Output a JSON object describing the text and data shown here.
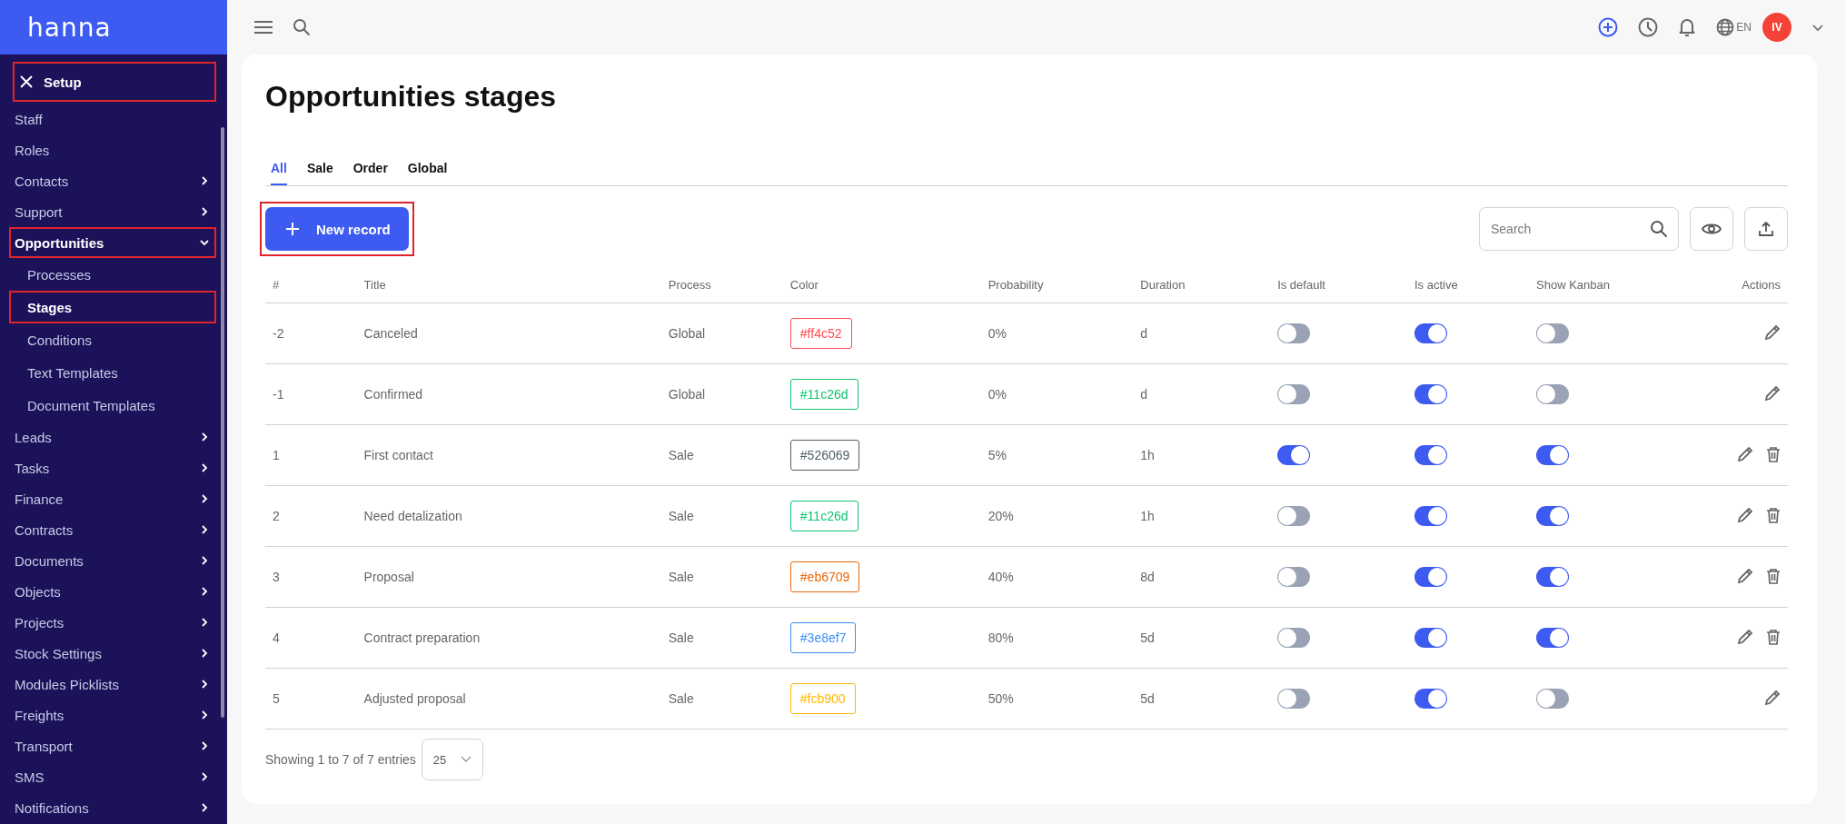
{
  "logo": "hanna",
  "sidebar": {
    "items": [
      {
        "kind": "header",
        "label": "Setup",
        "highlighted": true
      },
      {
        "kind": "link",
        "label": "Staff",
        "highlighted": false
      },
      {
        "kind": "link",
        "label": "Roles",
        "highlighted": false
      },
      {
        "kind": "group",
        "label": "Contacts",
        "expanded": false,
        "highlighted": false
      },
      {
        "kind": "group",
        "label": "Support",
        "expanded": false,
        "highlighted": false
      },
      {
        "kind": "group",
        "label": "Opportunities",
        "expanded": true,
        "highlighted": true,
        "children": [
          {
            "label": "Processes",
            "selected": false,
            "highlighted": false
          },
          {
            "label": "Stages",
            "selected": true,
            "highlighted": true
          },
          {
            "label": "Conditions",
            "selected": false,
            "highlighted": false
          },
          {
            "label": "Text Templates",
            "selected": false,
            "highlighted": false
          },
          {
            "label": "Document Templates",
            "selected": false,
            "highlighted": false
          }
        ]
      },
      {
        "kind": "group",
        "label": "Leads",
        "expanded": false,
        "highlighted": false
      },
      {
        "kind": "group",
        "label": "Tasks",
        "expanded": false,
        "highlighted": false
      },
      {
        "kind": "group",
        "label": "Finance",
        "expanded": false,
        "highlighted": false
      },
      {
        "kind": "group",
        "label": "Contracts",
        "expanded": false,
        "highlighted": false
      },
      {
        "kind": "group",
        "label": "Documents",
        "expanded": false,
        "highlighted": false
      },
      {
        "kind": "group",
        "label": "Objects",
        "expanded": false,
        "highlighted": false
      },
      {
        "kind": "group",
        "label": "Projects",
        "expanded": false,
        "highlighted": false
      },
      {
        "kind": "group",
        "label": "Stock Settings",
        "expanded": false,
        "highlighted": false
      },
      {
        "kind": "group",
        "label": "Modules Picklists",
        "expanded": false,
        "highlighted": false
      },
      {
        "kind": "group",
        "label": "Freights",
        "expanded": false,
        "highlighted": false
      },
      {
        "kind": "group",
        "label": "Transport",
        "expanded": false,
        "highlighted": false
      },
      {
        "kind": "group",
        "label": "SMS",
        "expanded": false,
        "highlighted": false
      },
      {
        "kind": "group",
        "label": "Notifications",
        "expanded": false,
        "highlighted": false
      }
    ]
  },
  "header": {
    "language": "EN",
    "avatar": "IV"
  },
  "page": {
    "title": "Opportunities stages",
    "tabs": [
      {
        "label": "All",
        "selected": true
      },
      {
        "label": "Sale",
        "selected": false
      },
      {
        "label": "Order",
        "selected": false
      },
      {
        "label": "Global",
        "selected": false
      }
    ],
    "new_button": {
      "label": "New record",
      "highlighted": true
    },
    "search": {
      "placeholder": "Search"
    },
    "table": {
      "columns": [
        "#",
        "Title",
        "Process",
        "Color",
        "Probability",
        "Duration",
        "Is default",
        "Is active",
        "Show Kanban",
        "Actions"
      ],
      "rows": [
        {
          "number": "-2",
          "title": "Canceled",
          "process": "Global",
          "color": "#ff4c52",
          "color_label": "#ff4c52",
          "probability": "0%",
          "duration": "d",
          "is_default": false,
          "is_active": true,
          "show_kanban": false,
          "deletable": false
        },
        {
          "number": "-1",
          "title": "Confirmed",
          "process": "Global",
          "color": "#11c26d",
          "color_label": "#11c26d",
          "probability": "0%",
          "duration": "d",
          "is_default": false,
          "is_active": true,
          "show_kanban": false,
          "deletable": false
        },
        {
          "number": "1",
          "title": "First contact",
          "process": "Sale",
          "color": "#526069",
          "color_label": "#526069",
          "probability": "5%",
          "duration": "1h",
          "is_default": true,
          "is_active": true,
          "show_kanban": true,
          "deletable": true
        },
        {
          "number": "2",
          "title": "Need detalization",
          "process": "Sale",
          "color": "#11c26d",
          "color_label": "#11c26d",
          "probability": "20%",
          "duration": "1h",
          "is_default": false,
          "is_active": true,
          "show_kanban": true,
          "deletable": true
        },
        {
          "number": "3",
          "title": "Proposal",
          "process": "Sale",
          "color": "#eb6709",
          "color_label": "#eb6709",
          "probability": "40%",
          "duration": "8d",
          "is_default": false,
          "is_active": true,
          "show_kanban": true,
          "deletable": true
        },
        {
          "number": "4",
          "title": "Contract preparation",
          "process": "Sale",
          "color": "#3e8ef7",
          "color_label": "#3e8ef7",
          "probability": "80%",
          "duration": "5d",
          "is_default": false,
          "is_active": true,
          "show_kanban": true,
          "deletable": true
        },
        {
          "number": "5",
          "title": "Adjusted proposal",
          "process": "Sale",
          "color": "#fcb900",
          "color_label": "#fcb900",
          "probability": "50%",
          "duration": "5d",
          "is_default": false,
          "is_active": true,
          "show_kanban": false,
          "deletable": false
        }
      ]
    },
    "footer": {
      "info": "Showing 1 to 7 of 7 entries",
      "page_size": "25"
    }
  }
}
